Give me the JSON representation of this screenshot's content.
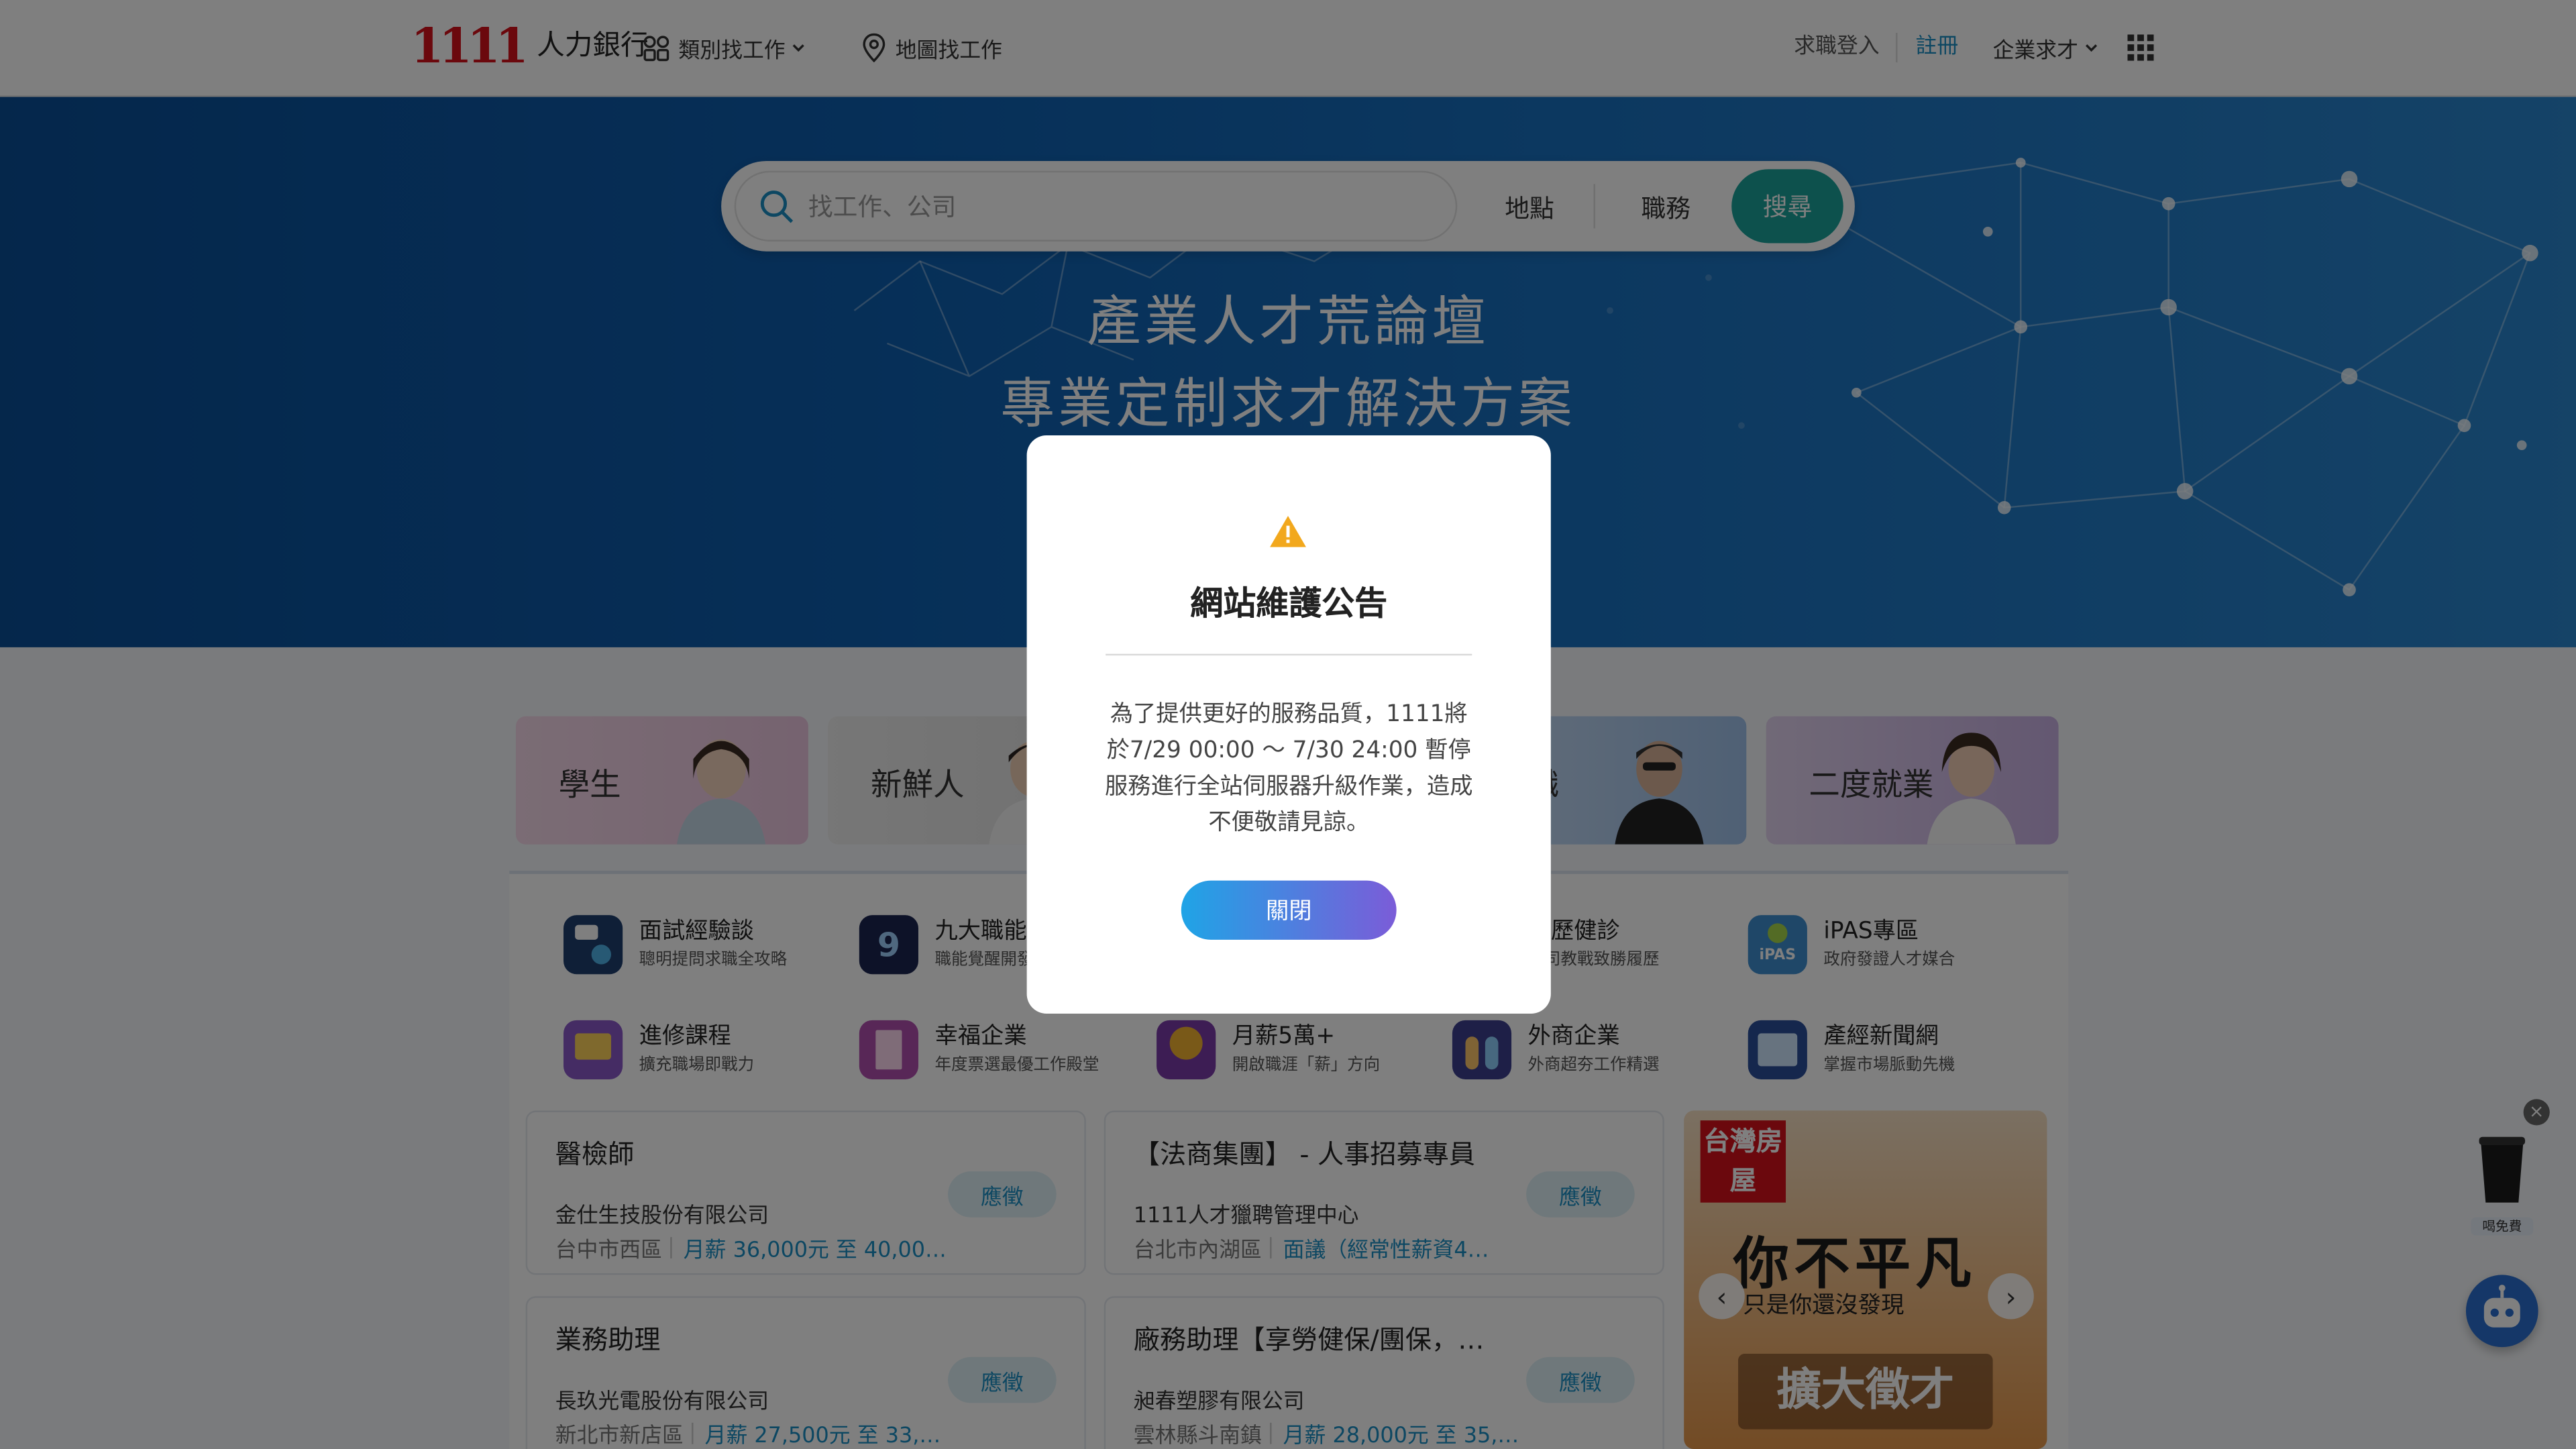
{
  "header": {
    "logo_number": "1111",
    "logo_text": "人力銀行",
    "nav_category": "類別找工作",
    "nav_map": "地圖找工作",
    "login": "求職登入",
    "register": "註冊",
    "enterprise": "企業求才"
  },
  "search": {
    "placeholder": "找工作、公司",
    "location": "地點",
    "job_type": "職務",
    "button": "搜尋"
  },
  "hero": {
    "line1": "產業人才荒論壇",
    "line2": "專業定制求才解決方案"
  },
  "audience": [
    {
      "label": "學生"
    },
    {
      "label": "新鮮人"
    },
    {
      "label": "轉職"
    },
    {
      "label": "二度就業"
    }
  ],
  "quick_links": [
    {
      "title": "面試經驗談",
      "sub": "聰明提問求職全攻略",
      "icon": "interview-icon"
    },
    {
      "title": "九大職能",
      "sub": "職能覺醒開發",
      "icon": "nine-skills-icon"
    },
    {
      "title": "履歷健診",
      "sub": "公司教戰致勝履歷",
      "icon": "resume-icon"
    },
    {
      "title": "iPAS專區",
      "sub": "政府發證人才媒合",
      "icon": "ipas-icon"
    },
    {
      "title": "進修課程",
      "sub": "擴充職場即戰力",
      "icon": "course-icon"
    },
    {
      "title": "幸福企業",
      "sub": "年度票選最優工作殿堂",
      "icon": "happy-company-icon"
    },
    {
      "title": "月薪5萬+",
      "sub": "開啟職涯「薪」方向",
      "icon": "salary-coin-icon"
    },
    {
      "title": "外商企業",
      "sub": "外商超夯工作精選",
      "icon": "foreign-company-icon"
    },
    {
      "title": "產經新聞網",
      "sub": "掌握市場脈動先機",
      "icon": "news-icon"
    }
  ],
  "jobs": [
    {
      "title": "醫檢師",
      "company": "金仕生技股份有限公司",
      "location": "台中市西區",
      "salary": "月薪 36,000元 至 40,00…",
      "apply": "應徵"
    },
    {
      "title": "【法商集團】 - 人事招募專員",
      "company": "1111人才獵聘管理中心",
      "location": "台北市內湖區",
      "salary": "面議（經常性薪資4…",
      "apply": "應徵"
    },
    {
      "title": "業務助理",
      "company": "長玖光電股份有限公司",
      "location": "新北市新店區",
      "salary": "月薪 27,500元 至 33,…",
      "apply": "應徵"
    },
    {
      "title": "廠務助理【享勞健保/團保，…",
      "company": "昶春塑膠有限公司",
      "location": "雲林縣斗南鎮",
      "salary": "月薪 28,000元 至 35,…",
      "apply": "應徵"
    }
  ],
  "banner": {
    "brand": "台灣房屋",
    "slogan": "你不平凡",
    "sub": "只是你還沒發現",
    "cta": "擴大徵才"
  },
  "widgets": {
    "coffee_label": "喝免費"
  },
  "modal": {
    "title": "網站維護公告",
    "body": "為了提供更好的服務品質，1111將於7/29 00:00 ～ 7/30 24:00 暫停服務進行全站伺服器升級作業，造成不便敬請見諒。",
    "button": "關閉"
  },
  "colors": {
    "brand_red": "#d6111a",
    "teal": "#1aa39a",
    "link_blue": "#1a8fc4",
    "hero_blue": "#0d5fb0",
    "modal_btn_start": "#1fa4e6",
    "modal_btn_end": "#7b5cd8"
  }
}
